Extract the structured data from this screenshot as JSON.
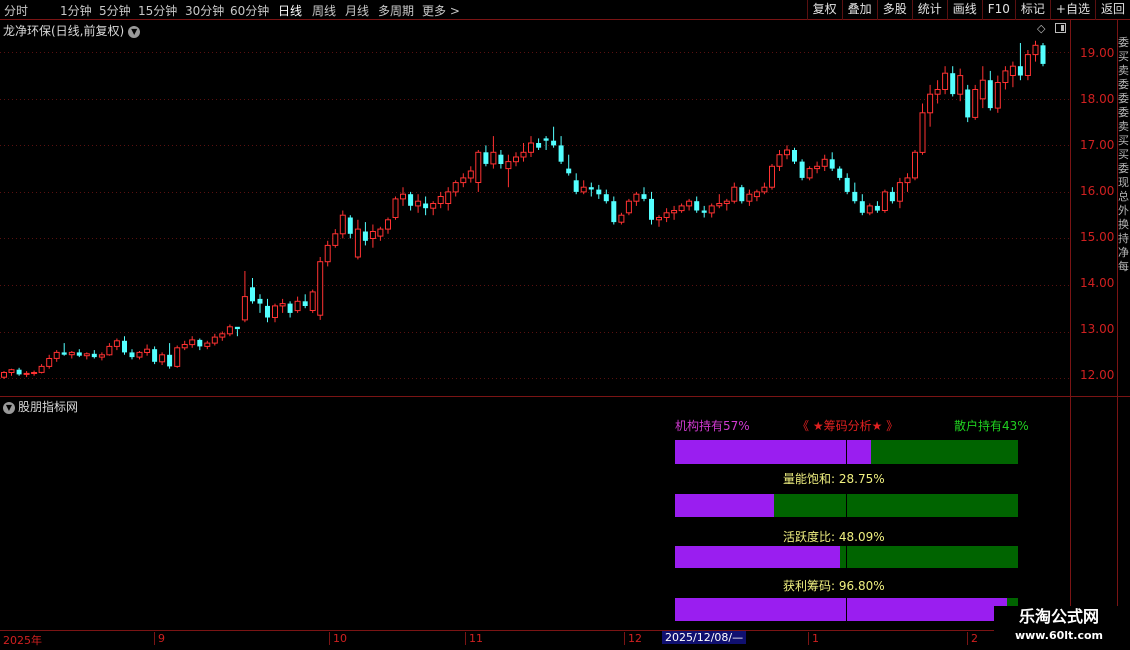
{
  "toolbar": {
    "timeframes": [
      "分时",
      "1分钟",
      "5分钟",
      "15分钟",
      "30分钟",
      "60分钟",
      "日线",
      "周线",
      "月线",
      "多周期",
      "更多 >"
    ],
    "active": "日线",
    "buttons": [
      "复权",
      "叠加",
      "多股",
      "统计",
      "画线",
      "F10",
      "标记",
      "+自选",
      "返回"
    ]
  },
  "chart": {
    "title": "龙净环保(日线,前复权)",
    "price_labels": [
      "19.00",
      "18.00",
      "17.00",
      "16.00",
      "15.00",
      "14.00",
      "13.00",
      "12.00"
    ],
    "colors": {
      "up": "#ff3232",
      "down": "#54ffff",
      "grid": "#5a1010"
    }
  },
  "chart_data": {
    "type": "candlestick",
    "ylim": [
      11.7,
      19.35
    ],
    "period_labels": [
      "2025年",
      "9",
      "10",
      "11",
      "12",
      "1",
      "2"
    ],
    "cursor_date": "2025/12/08/—",
    "ohlc": [
      [
        12.02,
        12.15,
        11.98,
        12.12
      ],
      [
        12.12,
        12.2,
        12.05,
        12.18
      ],
      [
        12.18,
        12.22,
        12.05,
        12.08
      ],
      [
        12.08,
        12.15,
        12.02,
        12.1
      ],
      [
        12.1,
        12.16,
        12.05,
        12.12
      ],
      [
        12.12,
        12.3,
        12.1,
        12.25
      ],
      [
        12.25,
        12.5,
        12.2,
        12.42
      ],
      [
        12.42,
        12.6,
        12.35,
        12.55
      ],
      [
        12.55,
        12.75,
        12.48,
        12.5
      ],
      [
        12.5,
        12.58,
        12.42,
        12.55
      ],
      [
        12.55,
        12.62,
        12.45,
        12.48
      ],
      [
        12.48,
        12.55,
        12.4,
        12.52
      ],
      [
        12.52,
        12.6,
        12.42,
        12.45
      ],
      [
        12.45,
        12.55,
        12.38,
        12.5
      ],
      [
        12.5,
        12.75,
        12.48,
        12.68
      ],
      [
        12.68,
        12.85,
        12.6,
        12.8
      ],
      [
        12.8,
        12.9,
        12.5,
        12.55
      ],
      [
        12.55,
        12.62,
        12.4,
        12.45
      ],
      [
        12.45,
        12.58,
        12.4,
        12.55
      ],
      [
        12.55,
        12.72,
        12.48,
        12.62
      ],
      [
        12.62,
        12.68,
        12.3,
        12.35
      ],
      [
        12.35,
        12.55,
        12.28,
        12.5
      ],
      [
        12.5,
        12.75,
        12.2,
        12.25
      ],
      [
        12.25,
        12.7,
        12.22,
        12.65
      ],
      [
        12.65,
        12.8,
        12.6,
        12.72
      ],
      [
        12.72,
        12.9,
        12.65,
        12.82
      ],
      [
        12.82,
        12.85,
        12.6,
        12.68
      ],
      [
        12.68,
        12.8,
        12.62,
        12.75
      ],
      [
        12.75,
        12.95,
        12.7,
        12.88
      ],
      [
        12.88,
        13.0,
        12.8,
        12.95
      ],
      [
        12.95,
        13.15,
        12.9,
        13.1
      ],
      [
        13.1,
        13.05,
        12.9,
        13.05
      ],
      [
        13.25,
        14.3,
        13.2,
        13.75
      ],
      [
        13.95,
        14.15,
        13.6,
        13.65
      ],
      [
        13.7,
        13.8,
        13.4,
        13.6
      ],
      [
        13.55,
        13.7,
        13.2,
        13.3
      ],
      [
        13.3,
        13.6,
        13.2,
        13.55
      ],
      [
        13.55,
        13.7,
        13.4,
        13.6
      ],
      [
        13.6,
        13.65,
        13.3,
        13.4
      ],
      [
        13.45,
        13.75,
        13.4,
        13.65
      ],
      [
        13.65,
        13.8,
        13.5,
        13.55
      ],
      [
        13.45,
        13.9,
        13.4,
        13.85
      ],
      [
        13.35,
        14.6,
        13.25,
        14.5
      ],
      [
        14.5,
        14.95,
        14.4,
        14.85
      ],
      [
        14.85,
        15.2,
        14.8,
        15.1
      ],
      [
        15.1,
        15.6,
        15.0,
        15.5
      ],
      [
        15.45,
        15.5,
        15.0,
        15.1
      ],
      [
        14.6,
        15.4,
        14.55,
        15.2
      ],
      [
        15.15,
        15.35,
        14.85,
        14.95
      ],
      [
        15.0,
        15.3,
        14.8,
        15.15
      ],
      [
        15.05,
        15.25,
        14.95,
        15.2
      ],
      [
        15.2,
        15.45,
        15.1,
        15.4
      ],
      [
        15.45,
        15.9,
        15.4,
        15.85
      ],
      [
        15.85,
        16.1,
        15.7,
        15.95
      ],
      [
        15.95,
        16.0,
        15.6,
        15.7
      ],
      [
        15.7,
        15.95,
        15.55,
        15.8
      ],
      [
        15.75,
        15.9,
        15.5,
        15.65
      ],
      [
        15.65,
        15.8,
        15.5,
        15.75
      ],
      [
        15.75,
        16.0,
        15.65,
        15.9
      ],
      [
        15.75,
        16.1,
        15.6,
        16.0
      ],
      [
        16.0,
        16.25,
        15.9,
        16.2
      ],
      [
        16.2,
        16.4,
        16.1,
        16.3
      ],
      [
        16.3,
        16.55,
        16.2,
        16.45
      ],
      [
        16.2,
        16.9,
        16.0,
        16.85
      ],
      [
        16.85,
        17.0,
        16.55,
        16.6
      ],
      [
        16.6,
        17.2,
        16.5,
        16.85
      ],
      [
        16.8,
        16.9,
        16.5,
        16.6
      ],
      [
        16.5,
        16.8,
        16.1,
        16.65
      ],
      [
        16.65,
        16.85,
        16.55,
        16.75
      ],
      [
        16.75,
        17.05,
        16.65,
        16.85
      ],
      [
        16.85,
        17.2,
        16.75,
        17.05
      ],
      [
        17.05,
        17.15,
        16.9,
        16.95
      ],
      [
        17.15,
        17.2,
        16.9,
        17.1
      ],
      [
        17.1,
        17.4,
        16.95,
        17.0
      ],
      [
        17.0,
        17.2,
        16.6,
        16.65
      ],
      [
        16.5,
        16.8,
        16.35,
        16.4
      ],
      [
        16.25,
        16.4,
        15.95,
        16.0
      ],
      [
        16.0,
        16.25,
        15.95,
        16.1
      ],
      [
        16.1,
        16.2,
        15.9,
        16.05
      ],
      [
        16.05,
        16.15,
        15.85,
        15.95
      ],
      [
        15.95,
        16.05,
        15.75,
        15.8
      ],
      [
        15.8,
        15.9,
        15.3,
        15.35
      ],
      [
        15.35,
        15.55,
        15.3,
        15.5
      ],
      [
        15.55,
        15.85,
        15.5,
        15.8
      ],
      [
        15.8,
        16.0,
        15.7,
        15.95
      ],
      [
        15.95,
        16.1,
        15.8,
        15.85
      ],
      [
        15.85,
        16.0,
        15.3,
        15.4
      ],
      [
        15.4,
        15.5,
        15.25,
        15.45
      ],
      [
        15.45,
        15.65,
        15.35,
        15.55
      ],
      [
        15.55,
        15.7,
        15.4,
        15.6
      ],
      [
        15.6,
        15.75,
        15.55,
        15.7
      ],
      [
        15.7,
        15.85,
        15.6,
        15.8
      ],
      [
        15.8,
        15.9,
        15.55,
        15.6
      ],
      [
        15.6,
        15.7,
        15.45,
        15.55
      ],
      [
        15.55,
        15.75,
        15.45,
        15.7
      ],
      [
        15.7,
        15.95,
        15.65,
        15.75
      ],
      [
        15.75,
        15.85,
        15.6,
        15.8
      ],
      [
        15.8,
        16.2,
        15.75,
        16.1
      ],
      [
        16.1,
        16.15,
        15.75,
        15.8
      ],
      [
        15.8,
        16.05,
        15.7,
        15.95
      ],
      [
        15.9,
        16.05,
        15.8,
        16.0
      ],
      [
        16.0,
        16.2,
        15.95,
        16.1
      ],
      [
        16.1,
        16.6,
        16.05,
        16.55
      ],
      [
        16.55,
        16.9,
        16.45,
        16.8
      ],
      [
        16.8,
        17.0,
        16.7,
        16.9
      ],
      [
        16.9,
        16.95,
        16.6,
        16.65
      ],
      [
        16.65,
        16.7,
        16.25,
        16.3
      ],
      [
        16.3,
        16.55,
        16.25,
        16.5
      ],
      [
        16.5,
        16.65,
        16.4,
        16.55
      ],
      [
        16.55,
        16.8,
        16.45,
        16.7
      ],
      [
        16.7,
        16.85,
        16.45,
        16.5
      ],
      [
        16.5,
        16.55,
        16.25,
        16.3
      ],
      [
        16.3,
        16.4,
        15.95,
        16.0
      ],
      [
        16.0,
        16.2,
        15.75,
        15.8
      ],
      [
        15.8,
        15.95,
        15.5,
        15.55
      ],
      [
        15.55,
        15.75,
        15.5,
        15.7
      ],
      [
        15.7,
        15.8,
        15.55,
        15.6
      ],
      [
        15.6,
        16.05,
        15.55,
        16.0
      ],
      [
        16.0,
        16.1,
        15.75,
        15.8
      ],
      [
        15.8,
        16.3,
        15.65,
        16.2
      ],
      [
        16.2,
        16.4,
        16.0,
        16.3
      ],
      [
        16.3,
        16.9,
        16.25,
        16.85
      ],
      [
        16.85,
        17.9,
        16.8,
        17.7
      ],
      [
        17.7,
        18.3,
        17.4,
        18.1
      ],
      [
        18.1,
        18.4,
        17.9,
        18.2
      ],
      [
        18.2,
        18.7,
        18.1,
        18.55
      ],
      [
        18.55,
        18.7,
        18.05,
        18.1
      ],
      [
        18.1,
        18.65,
        17.95,
        18.5
      ],
      [
        18.2,
        18.3,
        17.5,
        17.6
      ],
      [
        17.6,
        18.3,
        17.55,
        18.2
      ],
      [
        18.0,
        18.7,
        17.8,
        18.4
      ],
      [
        18.4,
        18.6,
        17.75,
        17.8
      ],
      [
        17.8,
        18.5,
        17.7,
        18.35
      ],
      [
        18.35,
        18.7,
        18.2,
        18.6
      ],
      [
        18.5,
        18.8,
        18.25,
        18.7
      ],
      [
        18.7,
        19.2,
        18.4,
        18.5
      ],
      [
        18.5,
        19.05,
        18.4,
        18.95
      ],
      [
        18.95,
        19.25,
        18.8,
        19.15
      ],
      [
        19.15,
        19.2,
        18.7,
        18.75
      ]
    ]
  },
  "subchart": {
    "title": "股朋指标网",
    "inst_label": "机构持有57%",
    "retail_label": "散户持有43%",
    "chip_title": "《 ★筹码分析★ 》",
    "metrics": [
      {
        "label": "量能饱和:  28.75%",
        "value": 28.75
      },
      {
        "label": "活跃度比:  48.09%",
        "value": 48.09
      },
      {
        "label": "获利筹码:  96.80%",
        "value": 96.8
      }
    ],
    "institutional_share": 57
  },
  "right_edge_text": "委买卖委委委卖买买委现总外换持净每",
  "watermark": {
    "name": "乐淘公式网",
    "url": "www.60lt.com"
  }
}
